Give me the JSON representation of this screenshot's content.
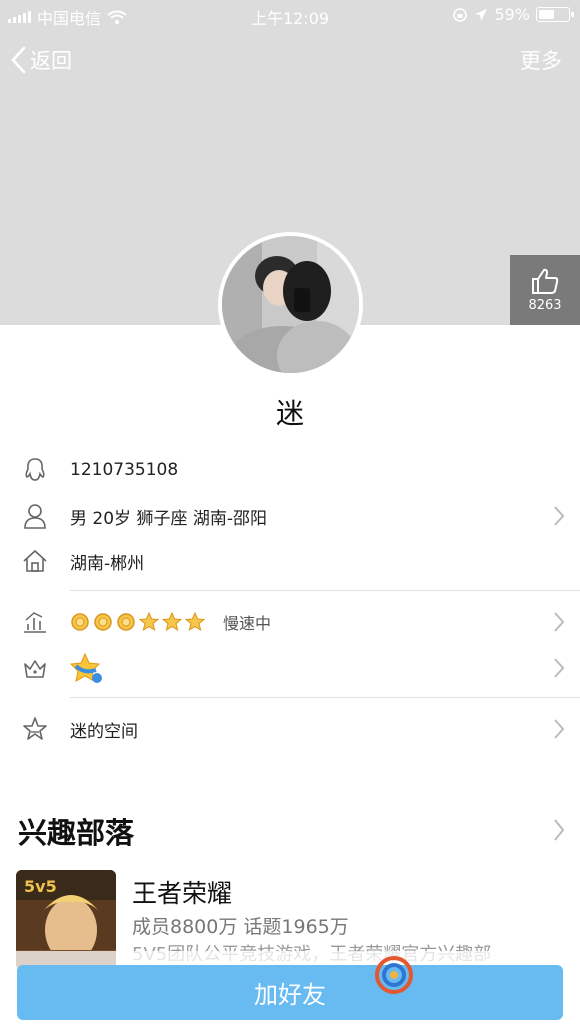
{
  "status_bar": {
    "carrier": "中国电信",
    "time": "上午12:09",
    "battery_text": "59%",
    "battery_level": 0.59
  },
  "nav": {
    "back_label": "返回",
    "more_label": "更多"
  },
  "like": {
    "count": "8263"
  },
  "profile": {
    "nickname": "迷"
  },
  "info": {
    "qq_number": "1210735108",
    "basic": "男 20岁 狮子座 湖南-邵阳",
    "location": "湖南-郴州",
    "level_status": "慢速中",
    "level_crowns": 3,
    "level_stars": 3,
    "space_label": "迷的空间"
  },
  "interest": {
    "section_title": "兴趣部落",
    "item": {
      "name": "王者荣耀",
      "stats": "成员8800万 话题1965万",
      "description": "5V5团队公平竞技游戏，王者荣耀官方兴趣部"
    }
  },
  "actions": {
    "add_friend": "加好友"
  },
  "colors": {
    "header_bg": "#dcdcdc",
    "primary": "#67bbf1",
    "like_bg": "#7a7a7a"
  },
  "icons": {
    "qq": "penguin-icon",
    "user": "person-icon",
    "home": "home-icon",
    "level": "chart-icon",
    "vip": "crown-icon",
    "space": "star-icon",
    "chevron": "chevron-right-icon",
    "like": "thumbs-up-icon"
  }
}
